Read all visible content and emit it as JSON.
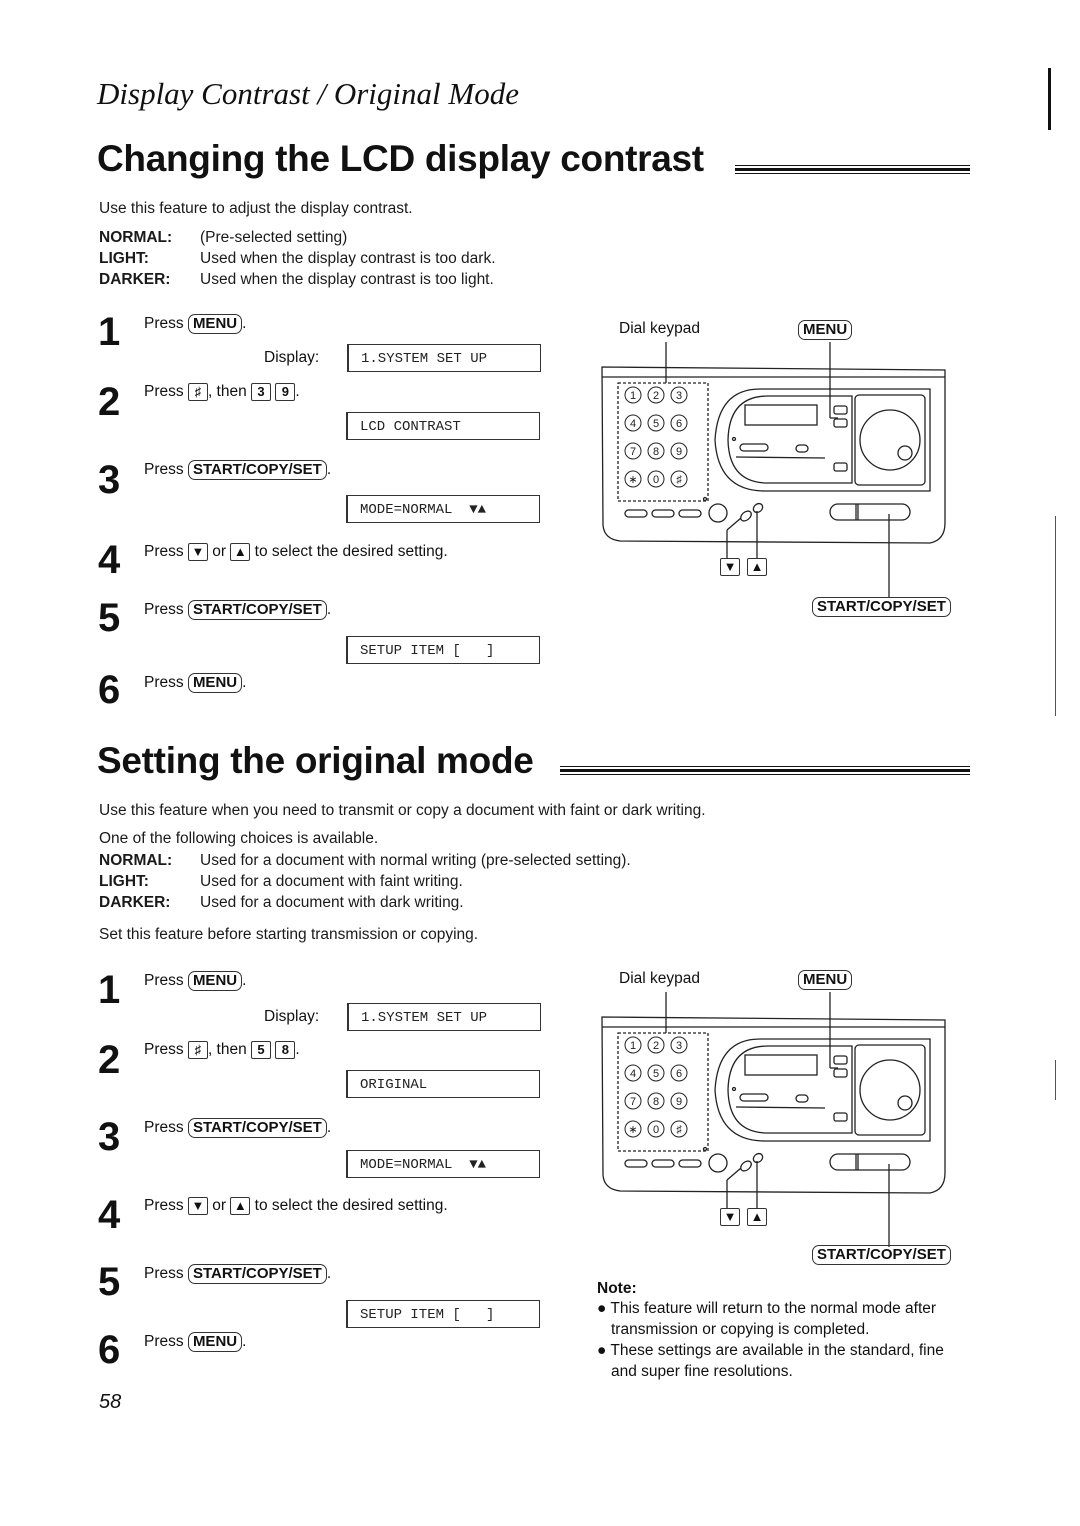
{
  "header": {
    "section_title": "Display Contrast / Original Mode"
  },
  "contrast": {
    "title": "Changing the LCD display contrast",
    "intro": "Use this feature to adjust the display contrast.",
    "options": [
      {
        "term": "NORMAL:",
        "desc": "(Pre-selected setting)"
      },
      {
        "term": "LIGHT:",
        "desc": "Used when the display contrast is too dark."
      },
      {
        "term": "DARKER:",
        "desc": "Used when the display contrast is too light."
      }
    ],
    "steps": [
      {
        "num": "1",
        "press": "Press",
        "key": "MENU",
        "after": "."
      },
      {
        "num": "2",
        "press": "Press",
        "key": "♯",
        "mid": ", then",
        "key2": "3",
        "key3": "9",
        "after": "."
      },
      {
        "num": "3",
        "press": "Press",
        "key": "START/COPY/SET",
        "after": "."
      },
      {
        "num": "4",
        "press": "Press",
        "key": "▼",
        "mid": "or",
        "key2": "▲",
        "after": "to select the desired setting."
      },
      {
        "num": "5",
        "press": "Press",
        "key": "START/COPY/SET",
        "after": "."
      },
      {
        "num": "6",
        "press": "Press",
        "key": "MENU",
        "after": "."
      }
    ],
    "display_label": "Display:",
    "lcd": [
      "1.SYSTEM SET UP",
      "LCD CONTRAST",
      "MODE=NORMAL  ▼▲",
      "SETUP ITEM [   ]"
    ]
  },
  "original": {
    "title": "Setting the original mode",
    "intro": "Use this feature when you need to transmit or copy a document with faint or dark writing.",
    "choices_intro": "One of the following choices is available.",
    "options": [
      {
        "term": "NORMAL:",
        "desc": "Used for a document with normal writing (pre-selected setting)."
      },
      {
        "term": "LIGHT:",
        "desc": "Used for a document with faint writing."
      },
      {
        "term": "DARKER:",
        "desc": "Used for a document with dark writing."
      }
    ],
    "set_before": "Set this feature before starting transmission or copying.",
    "steps": [
      {
        "num": "1",
        "press": "Press",
        "key": "MENU",
        "after": "."
      },
      {
        "num": "2",
        "press": "Press",
        "key": "♯",
        "mid": ", then",
        "key2": "5",
        "key3": "8",
        "after": "."
      },
      {
        "num": "3",
        "press": "Press",
        "key": "START/COPY/SET",
        "after": "."
      },
      {
        "num": "4",
        "press": "Press",
        "key": "▼",
        "mid": "or",
        "key2": "▲",
        "after": "to select the desired setting."
      },
      {
        "num": "5",
        "press": "Press",
        "key": "START/COPY/SET",
        "after": "."
      },
      {
        "num": "6",
        "press": "Press",
        "key": "MENU",
        "after": "."
      }
    ],
    "display_label": "Display:",
    "lcd": [
      "1.SYSTEM SET UP",
      "ORIGINAL",
      "MODE=NORMAL  ▼▲",
      "SETUP ITEM [   ]"
    ],
    "note": {
      "title": "Note:",
      "items": [
        "This feature will return to the normal mode after transmission or copying is completed.",
        "These settings are available in the standard, fine and super fine resolutions."
      ]
    }
  },
  "diagram": {
    "dial_keypad_label": "Dial keypad",
    "menu_label": "MENU",
    "start_label": "START/COPY/SET",
    "down_label": "▼",
    "up_label": "▲",
    "keys": [
      "1",
      "2",
      "3",
      "4",
      "5",
      "6",
      "7",
      "8",
      "9",
      "∗",
      "0",
      "♯"
    ]
  },
  "footer": {
    "page_number": "58"
  }
}
